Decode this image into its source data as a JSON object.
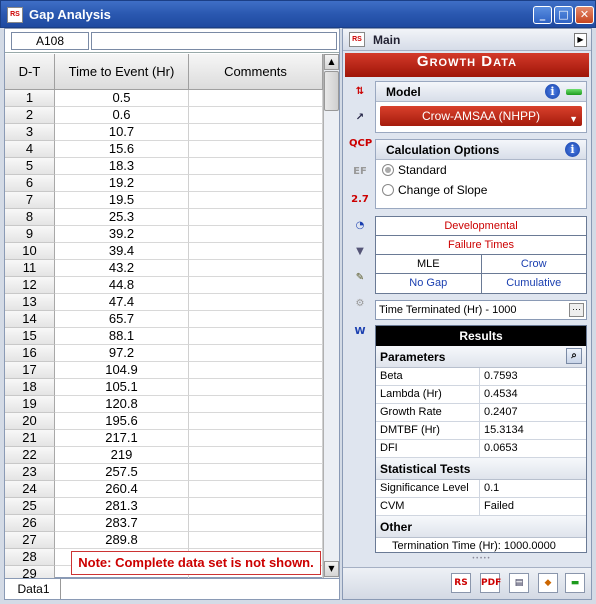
{
  "window": {
    "title": "Gap Analysis",
    "app_icon": "RS",
    "minimize": "_",
    "maximize": "□",
    "close": "✕"
  },
  "cellbar": {
    "ref": "A108",
    "value": ""
  },
  "grid": {
    "headers": [
      "D-T",
      "Time to Event (Hr)",
      "Comments"
    ],
    "rows": [
      {
        "n": "1",
        "v": "0.5"
      },
      {
        "n": "2",
        "v": "0.6"
      },
      {
        "n": "3",
        "v": "10.7"
      },
      {
        "n": "4",
        "v": "15.6"
      },
      {
        "n": "5",
        "v": "18.3"
      },
      {
        "n": "6",
        "v": "19.2"
      },
      {
        "n": "7",
        "v": "19.5"
      },
      {
        "n": "8",
        "v": "25.3"
      },
      {
        "n": "9",
        "v": "39.2"
      },
      {
        "n": "10",
        "v": "39.4"
      },
      {
        "n": "11",
        "v": "43.2"
      },
      {
        "n": "12",
        "v": "44.8"
      },
      {
        "n": "13",
        "v": "47.4"
      },
      {
        "n": "14",
        "v": "65.7"
      },
      {
        "n": "15",
        "v": "88.1"
      },
      {
        "n": "16",
        "v": "97.2"
      },
      {
        "n": "17",
        "v": "104.9"
      },
      {
        "n": "18",
        "v": "105.1"
      },
      {
        "n": "19",
        "v": "120.8"
      },
      {
        "n": "20",
        "v": "195.6"
      },
      {
        "n": "21",
        "v": "217.1"
      },
      {
        "n": "22",
        "v": "219"
      },
      {
        "n": "23",
        "v": "257.5"
      },
      {
        "n": "24",
        "v": "260.4"
      },
      {
        "n": "25",
        "v": "281.3"
      },
      {
        "n": "26",
        "v": "283.7"
      },
      {
        "n": "27",
        "v": "289.8"
      },
      {
        "n": "28",
        "v": ""
      },
      {
        "n": "29",
        "v": ""
      }
    ]
  },
  "note": "Note: Complete data set is not shown.",
  "sheet_tab": "Data1",
  "right": {
    "main_label": "Main",
    "header": "Growth Data",
    "tool_icons": [
      "data-type-icon",
      "plot-icon",
      "qcp-icon",
      "ef-icon",
      "transfer-icon",
      "gauge-icon",
      "filter-icon",
      "report-icon",
      "generate-icon",
      "weibull-icon"
    ],
    "tool_glyphs": [
      "⇅",
      "↗",
      "QCP",
      "EF",
      "2.7",
      "◔",
      "▼",
      "✎",
      "⚙",
      "W"
    ],
    "model": {
      "title": "Model",
      "value": "Crow-AMSAA (NHPP)"
    },
    "calc": {
      "title": "Calculation Options",
      "standard": "Standard",
      "change": "Change of Slope"
    },
    "options": {
      "r1": "Developmental",
      "r2": "Failure Times",
      "r3a": "MLE",
      "r3b": "Crow",
      "r4a": "No Gap",
      "r4b": "Cumulative"
    },
    "termination": "Time Terminated (Hr) - 1000",
    "results": {
      "title": "Results",
      "parameters": "Parameters",
      "params": [
        {
          "k": "Beta",
          "v": "0.7593"
        },
        {
          "k": "Lambda (Hr)",
          "v": "0.4534"
        },
        {
          "k": "Growth Rate",
          "v": "0.2407"
        },
        {
          "k": "DMTBF (Hr)",
          "v": "15.3134"
        },
        {
          "k": "DFI",
          "v": "0.0653"
        }
      ],
      "stat_tests": "Statistical Tests",
      "tests": [
        {
          "k": "Significance Level",
          "v": "0.1"
        },
        {
          "k": "CVM",
          "v": "Failed"
        }
      ],
      "other": "Other",
      "termination_time": "Termination Time (Hr): 1000.0000"
    },
    "bottom_buttons": [
      "RS",
      "PDF",
      "▤",
      "◆",
      "▬"
    ]
  },
  "colors": {
    "accent_red": "#b8200f",
    "title_blue": "#2a58b0"
  }
}
